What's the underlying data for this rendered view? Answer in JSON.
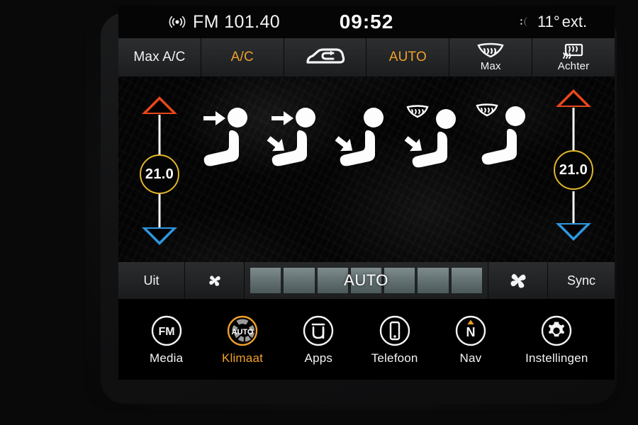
{
  "device": {
    "name": "uconnect-climate-screen"
  },
  "statusbar": {
    "radio_icon": "radio-broadcast-icon",
    "radio_band": "FM 101.40",
    "time": "09:52",
    "night_icon": "moon-icon",
    "temp_value": "11°",
    "temp_unit": "ext."
  },
  "top_controls": [
    {
      "label": "Max A/C",
      "active": false,
      "icon": null
    },
    {
      "label": "A/C",
      "active": true,
      "icon": null
    },
    {
      "label": "",
      "active": false,
      "icon": "recirculation-icon"
    },
    {
      "label": "AUTO",
      "active": true,
      "icon": null
    },
    {
      "label": "Max",
      "active": false,
      "icon": "front-defrost-icon"
    },
    {
      "label": "Achter",
      "active": false,
      "icon": "rear-defrost-icon"
    }
  ],
  "climate": {
    "left": {
      "up_icon": "temperature-up-triangle",
      "down_icon": "temperature-down-triangle",
      "value": "21.0",
      "up_color": "#e8471a",
      "down_color": "#2e97e0",
      "ring_color": "#e0b52a"
    },
    "right": {
      "up_icon": "temperature-up-triangle",
      "down_icon": "temperature-down-triangle",
      "value": "21.0",
      "up_color": "#e8471a",
      "down_color": "#2e97e0",
      "ring_color": "#e0b52a"
    },
    "airflow_modes": [
      {
        "name": "airflow-face-icon",
        "face": true,
        "feet": false,
        "defrost": false
      },
      {
        "name": "airflow-face-feet-icon",
        "face": true,
        "feet": true,
        "defrost": false
      },
      {
        "name": "airflow-feet-icon",
        "face": false,
        "feet": true,
        "defrost": false
      },
      {
        "name": "airflow-defrost-feet-icon",
        "face": false,
        "feet": true,
        "defrost": true
      },
      {
        "name": "airflow-defrost-icon",
        "face": false,
        "feet": false,
        "defrost": true
      }
    ]
  },
  "fan": {
    "off_label": "Uit",
    "decrease_icon": "fan-small-icon",
    "increase_icon": "fan-large-icon",
    "sync_label": "Sync",
    "mode_label": "AUTO",
    "segments": 7
  },
  "nav": [
    {
      "label": "Media",
      "icon": "fm-radio-icon",
      "active": false
    },
    {
      "label": "Klimaat",
      "icon": "climate-auto-icon",
      "active": true
    },
    {
      "label": "Apps",
      "icon": "uconnect-apps-icon",
      "active": false
    },
    {
      "label": "Telefoon",
      "icon": "phone-icon",
      "active": false
    },
    {
      "label": "Nav",
      "icon": "compass-nav-icon",
      "active": false
    },
    {
      "label": "Instellingen",
      "icon": "gear-icon",
      "active": false
    }
  ],
  "colors": {
    "amber": "#f0a02a",
    "hot": "#e8471a",
    "cold": "#2e97e0",
    "ring": "#e0b52a"
  }
}
